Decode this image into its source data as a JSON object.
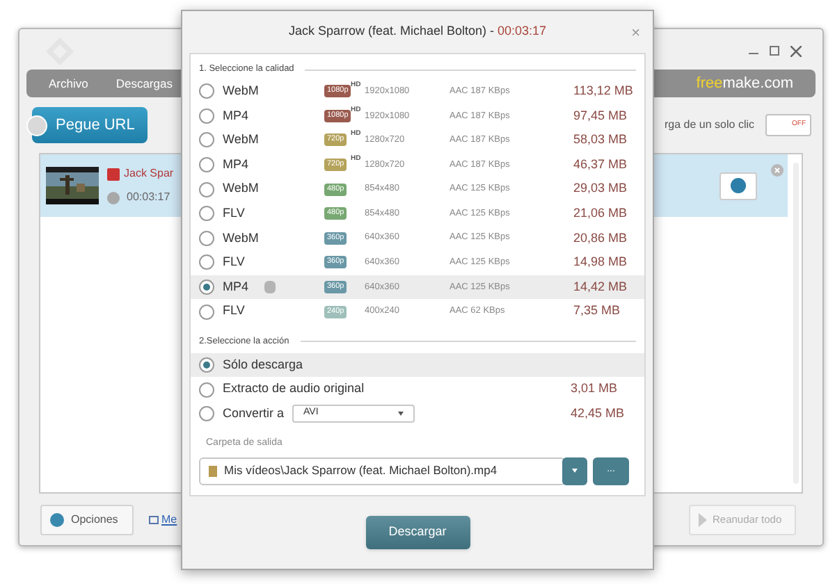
{
  "main_window": {
    "menu": [
      "Archivo",
      "Descargas"
    ],
    "brand": {
      "highlight": "free",
      "rest": "make.com"
    },
    "paste_button": "Pegue URL",
    "one_click": {
      "label": "rga de un solo clic",
      "on": false,
      "state_label": "OFF"
    },
    "downloads": [
      {
        "title": "Jack Spar",
        "duration": "00:03:17",
        "selected": true
      }
    ],
    "options_button": "Opciones",
    "like_link": "Me",
    "resume_button": {
      "label": "Reanudar todo",
      "disabled": true
    }
  },
  "dialog": {
    "title": "Jack Sparrow (feat. Michael Bolton) - ",
    "duration": "00:03:17",
    "close": "×",
    "quality_heading": "1. Seleccione la calidad",
    "qualities": [
      {
        "format": "WebM",
        "apple": false,
        "badge": "1080p",
        "hd": "HD",
        "color": "#9a5b4e",
        "resolution": "1920x1080",
        "audio": "AAC 187 KBps",
        "size": "113,12 MB",
        "selected": false
      },
      {
        "format": "MP4",
        "apple": false,
        "badge": "1080p",
        "hd": "HD",
        "color": "#9a5b4e",
        "resolution": "1920x1080",
        "audio": "AAC 187 KBps",
        "size": "97,45 MB",
        "selected": false
      },
      {
        "format": "WebM",
        "apple": false,
        "badge": "720p",
        "hd": "HD",
        "color": "#b5a35c",
        "resolution": "1280x720",
        "audio": "AAC 187 KBps",
        "size": "58,03 MB",
        "selected": false
      },
      {
        "format": "MP4",
        "apple": false,
        "badge": "720p",
        "hd": "HD",
        "color": "#b5a35c",
        "resolution": "1280x720",
        "audio": "AAC 187 KBps",
        "size": "46,37 MB",
        "selected": false
      },
      {
        "format": "WebM",
        "apple": false,
        "badge": "480p",
        "color": "#78a872",
        "resolution": "854x480",
        "audio": "AAC 125 KBps",
        "size": "29,03 MB",
        "selected": false
      },
      {
        "format": "FLV",
        "apple": false,
        "badge": "480p",
        "color": "#78a872",
        "resolution": "854x480",
        "audio": "AAC 125 KBps",
        "size": "21,06 MB",
        "selected": false
      },
      {
        "format": "WebM",
        "apple": false,
        "badge": "360p",
        "color": "#6a98a6",
        "resolution": "640x360",
        "audio": "AAC 125 KBps",
        "size": "20,86 MB",
        "selected": false
      },
      {
        "format": "FLV",
        "apple": false,
        "badge": "360p",
        "color": "#6a98a6",
        "resolution": "640x360",
        "audio": "AAC 125 KBps",
        "size": "14,98 MB",
        "selected": false
      },
      {
        "format": "MP4",
        "apple": true,
        "badge": "360p",
        "color": "#6a98a6",
        "resolution": "640x360",
        "audio": "AAC 125 KBps",
        "size": "14,42 MB",
        "selected": true
      },
      {
        "format": "FLV",
        "apple": false,
        "badge": "240p",
        "color": "#9fc0ba",
        "resolution": "400x240",
        "audio": "AAC 62 KBps",
        "size": "7,35 MB",
        "selected": false
      }
    ],
    "action_heading": "2.Seleccione la acción",
    "actions": [
      {
        "kind": "plain",
        "label": "Sólo descarga",
        "selected": true
      },
      {
        "kind": "plain",
        "label": "Extracto de audio original",
        "size": "3,01 MB",
        "selected": false
      },
      {
        "kind": "convert",
        "label": "Convertir a",
        "format": "AVI",
        "size": "42,45 MB",
        "selected": false
      }
    ],
    "output_label": "Carpeta de salida",
    "output_path": "Mis vídeos\\Jack Sparrow (feat. Michael Bolton).mp4",
    "browse_button": "...",
    "download_button": "Descargar"
  }
}
